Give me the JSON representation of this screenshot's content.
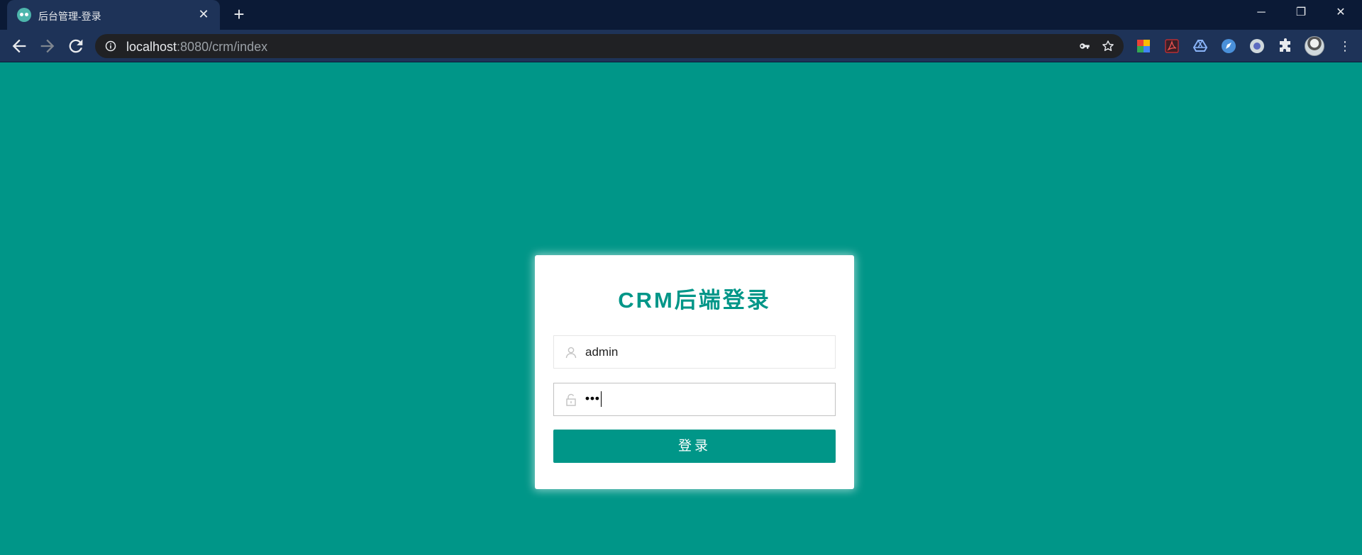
{
  "browser": {
    "tab": {
      "title": "后台管理-登录",
      "favicon": "layui-favicon-icon",
      "close_label": "✕"
    },
    "new_tab_label": "+",
    "window": {
      "minimize": "─",
      "maximize": "❐",
      "close": "✕"
    },
    "address": {
      "host": "localhost",
      "rest": ":8080/crm/index"
    },
    "extensions": [
      "color-picker-icon",
      "pdf-icon",
      "google-drive-icon",
      "rocket-icon",
      "circle-icon",
      "puzzle-icon"
    ],
    "menu_label": "⋮"
  },
  "login": {
    "title": "CRM后端登录",
    "username": {
      "value": "admin",
      "icon": "user-icon"
    },
    "password": {
      "masked": "•••",
      "icon": "lock-icon"
    },
    "submit_label": "登录"
  },
  "colors": {
    "primary": "#009688",
    "chrome_dark": "#0b1a36",
    "chrome_tab": "#1e3358"
  }
}
